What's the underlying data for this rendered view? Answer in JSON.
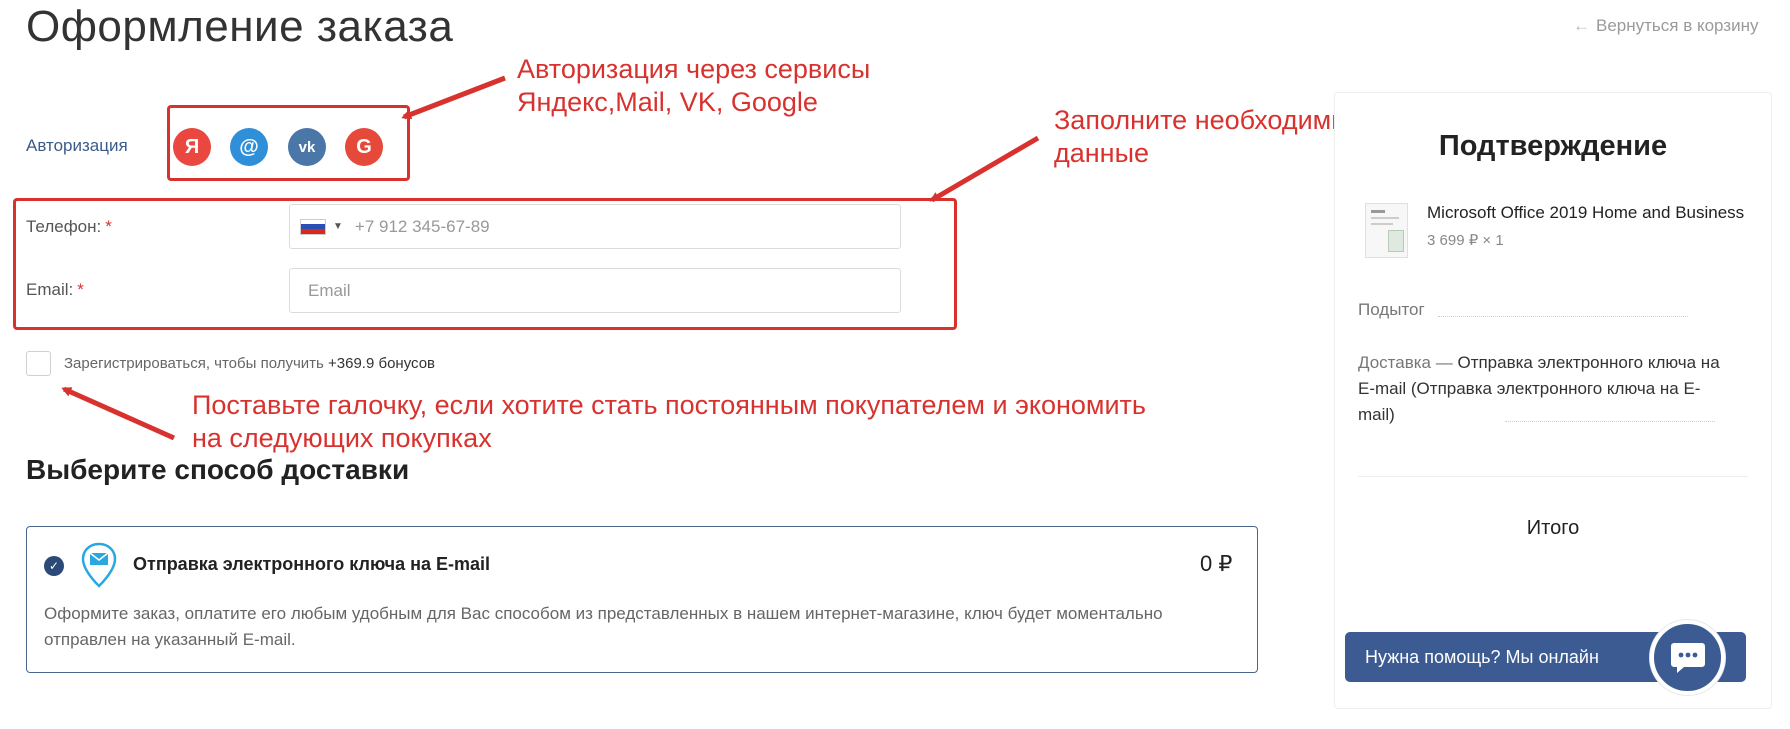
{
  "page": {
    "title": "Оформление заказа",
    "back_arrow": "←",
    "back_link": "Вернуться в корзину"
  },
  "auth": {
    "label": "Авторизация",
    "providers": [
      {
        "name": "Yandex",
        "glyph": "Я",
        "color": "#e9473f"
      },
      {
        "name": "Mail",
        "glyph": "@",
        "color": "#2f8fd8"
      },
      {
        "name": "VK",
        "glyph": "vk",
        "color": "#4a76a8"
      },
      {
        "name": "Google",
        "glyph": "G",
        "color": "#e5493a"
      }
    ]
  },
  "form": {
    "phone_label": "Телефон:",
    "phone_placeholder": "+7 912 345-67-89",
    "email_label": "Email:",
    "email_placeholder": "Email",
    "required_mark": "*"
  },
  "register": {
    "text": "Зарегистрироваться, чтобы получить",
    "bonus": "+369.9 бонусов"
  },
  "annotations": {
    "auth_line1": "Авторизация через сервисы",
    "auth_line2": "Яндекс,Mail, VK, Google",
    "fill_line1": "Заполните необходимые",
    "fill_line2": "данные",
    "check_line1": "Поставьте галочку, если хотите стать постоянным покупателем и экономить",
    "check_line2": "на следующих покупках"
  },
  "delivery": {
    "section_title": "Выберите способ доставки",
    "check_glyph": "✓",
    "option_name": "Отправка электронного ключа на E-mail",
    "price": "0 ₽",
    "description": "Оформите заказ, оплатите его любым удобным для Вас способом из представленных в нашем интернет-магазине, ключ будет моментально отправлен на указанный E-mail."
  },
  "summary": {
    "title": "Подтверждение",
    "product_name": "Microsoft Office 2019 Home and Business",
    "product_qty": "3 699 ₽ × 1",
    "subtotal_label": "Подытог",
    "delivery_label": "Доставка —",
    "delivery_value": "Отправка электронного ключа на E-mail (Отправка электронного ключа на E-mail)",
    "total_label": "Итого"
  },
  "help": {
    "label": "Нужна помощь? Мы онлайн"
  },
  "colors": {
    "annotation_red": "#d8322f",
    "brand_blue": "#3c5b92",
    "link_blue": "#3b5b8a"
  }
}
